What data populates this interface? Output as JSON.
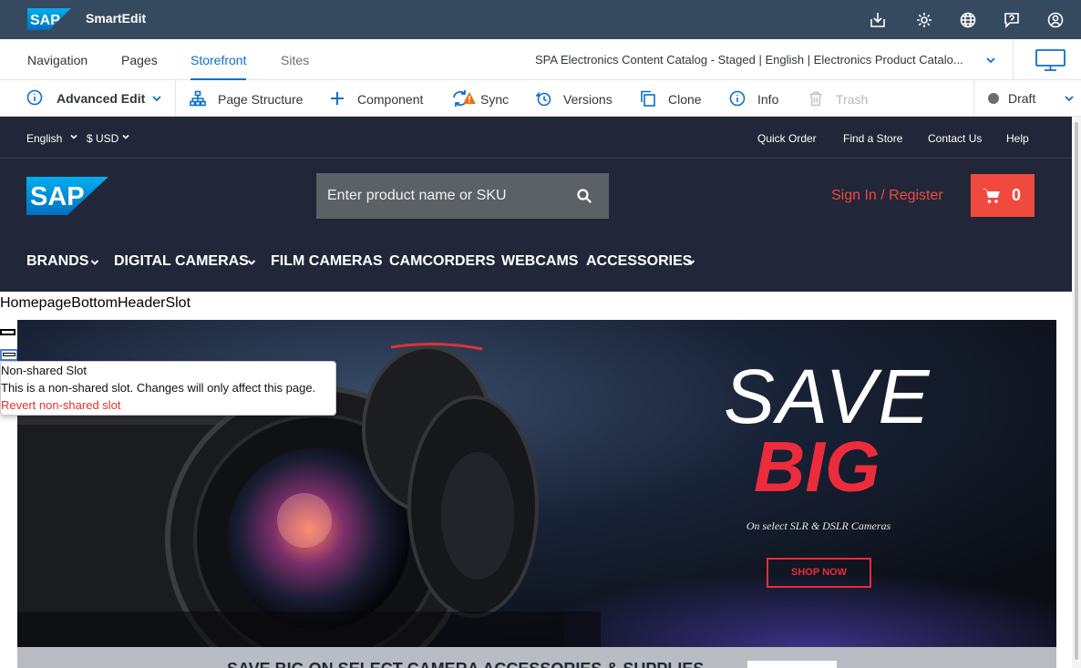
{
  "app": {
    "logo": "SAP",
    "title": "SmartEdit"
  },
  "topbar_icons": [
    "inbox-download-icon",
    "settings-icon",
    "globe-icon",
    "help-chat-icon",
    "user-account-icon"
  ],
  "nav": {
    "tabs": [
      "Navigation",
      "Pages",
      "Storefront",
      "Sites"
    ],
    "active_tab": "Storefront",
    "catalog": "SPA Electronics Content Catalog - Staged | English | Electronics Product Catalo..."
  },
  "toolbar": {
    "mode": "Advanced Edit",
    "items": [
      "Page Structure",
      "Component",
      "Sync",
      "Versions",
      "Clone",
      "Info",
      "Trash"
    ],
    "status": "Draft"
  },
  "storefront": {
    "language": "English",
    "currency": "$ USD",
    "util_links": [
      "Quick Order",
      "Find a Store",
      "Contact Us",
      "Help"
    ],
    "search_placeholder": "Enter product name or SKU",
    "sign_in": "Sign In / Register",
    "cart_count": "0",
    "categories": [
      "BRANDS",
      "DIGITAL CAMERAS",
      "FILM CAMERAS",
      "CAMCORDERS",
      "WEBCAMS",
      "ACCESSORIES"
    ],
    "slot_name": "HomepageBottomHeaderSlot",
    "banner": {
      "line1": "SAVE",
      "line2": "BIG",
      "subtitle": "On select SLR & DSLR Cameras",
      "cta": "SHOP NOW"
    },
    "next_band_text": "SAVE BIG ON SELECT CAMERA ACCESSORIES & SUPPLIES"
  },
  "tooltip": {
    "title": "Non-shared Slot",
    "body": "This is a non-shared slot. Changes will only affect this page.",
    "link": "Revert non-shared slot"
  },
  "colors": {
    "topbar": "#354a5f",
    "accent": "#0a6ed1",
    "store_bg": "#212738",
    "brand_red": "#f0493d"
  }
}
